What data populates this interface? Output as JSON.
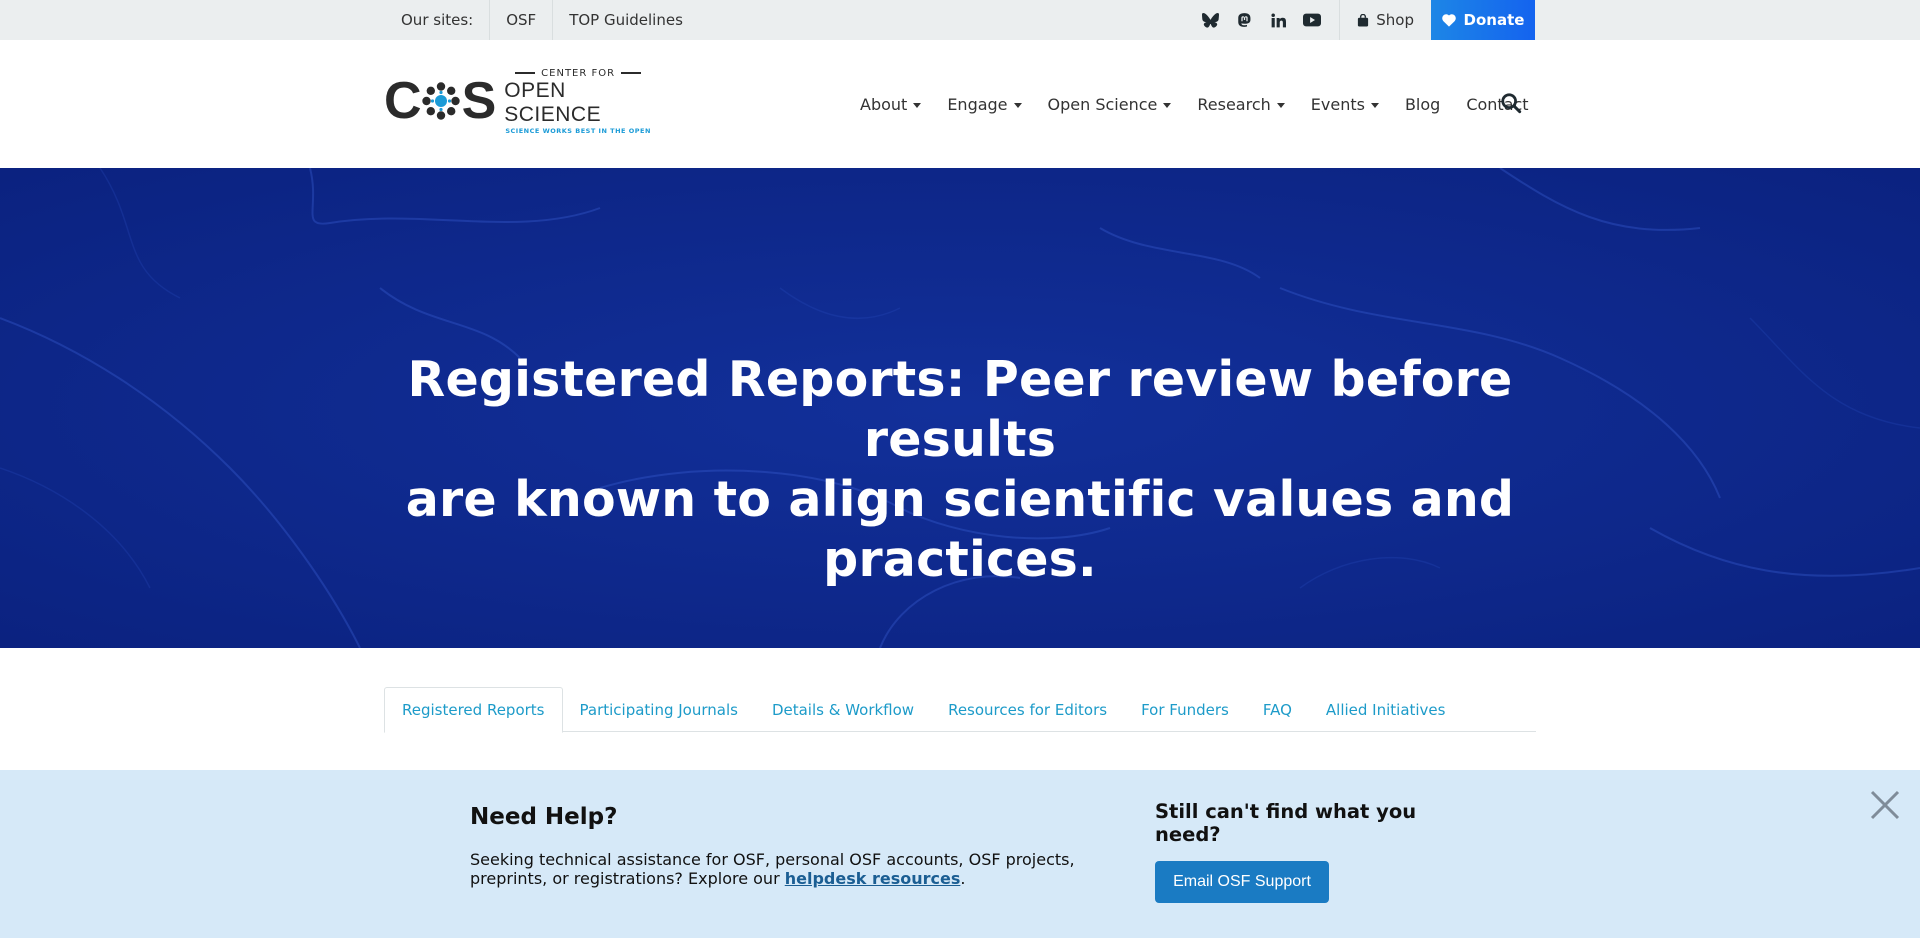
{
  "topbar": {
    "sites_label": "Our sites:",
    "sites": [
      "OSF",
      "TOP Guidelines"
    ],
    "social_icons": [
      "bluesky-icon",
      "mastodon-icon",
      "linkedin-icon",
      "youtube-icon"
    ],
    "shop_label": "Shop",
    "donate_label": "Donate"
  },
  "logo": {
    "line1": "CENTER FOR",
    "line2": "OPEN SCIENCE",
    "line3": "SCIENCE WORKS BEST IN THE OPEN"
  },
  "nav": {
    "items": [
      {
        "label": "About",
        "dropdown": true
      },
      {
        "label": "Engage",
        "dropdown": true
      },
      {
        "label": "Open Science",
        "dropdown": true
      },
      {
        "label": "Research",
        "dropdown": true
      },
      {
        "label": "Events",
        "dropdown": true
      },
      {
        "label": "Blog",
        "dropdown": false
      },
      {
        "label": "Contact",
        "dropdown": false
      }
    ]
  },
  "hero": {
    "title_line1": "Registered Reports: Peer review before results",
    "title_line2": "are known to align scientific values and practices."
  },
  "tabs": [
    {
      "label": "Registered Reports",
      "active": true
    },
    {
      "label": "Participating Journals",
      "active": false
    },
    {
      "label": "Details & Workflow",
      "active": false
    },
    {
      "label": "Resources for Editors",
      "active": false
    },
    {
      "label": "For Funders",
      "active": false
    },
    {
      "label": "FAQ",
      "active": false
    },
    {
      "label": "Allied Initiatives",
      "active": false
    }
  ],
  "help": {
    "title": "Need Help?",
    "text_before": "Seeking technical assistance for OSF, personal OSF accounts, OSF projects, preprints, or registrations? Explore our ",
    "link_text": "helpdesk resources",
    "text_after": ".",
    "right_title": "Still can't find what you need?",
    "button_label": "Email OSF Support"
  },
  "colors": {
    "hero_bg": "#0e288c",
    "donate_bg": "#1d86e6",
    "tab_link": "#1d9bc9",
    "help_bg": "#d6e9f8",
    "email_button": "#1a7bc3"
  }
}
